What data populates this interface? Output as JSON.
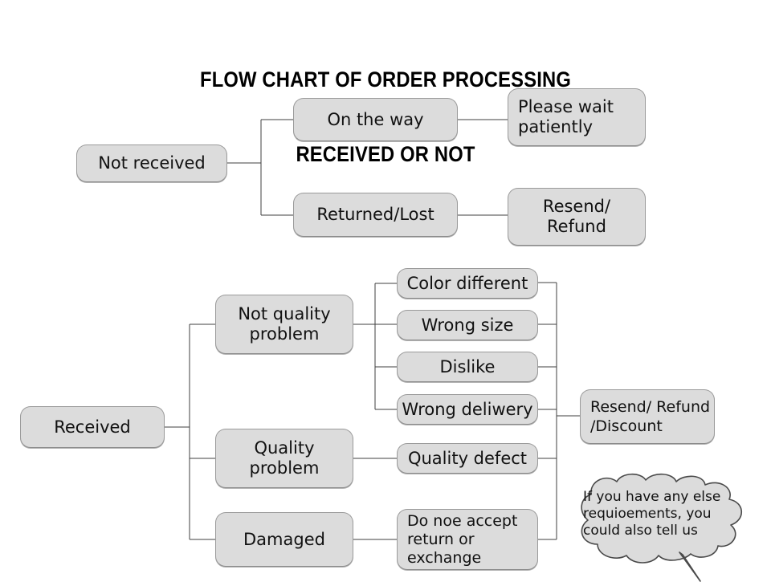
{
  "title": {
    "line1": "FLOW CHART OF ORDER PROCESSING",
    "line2": "RECEIVED OR NOT"
  },
  "colors": {
    "node_fill": "#dcdcdc",
    "node_border": "#9a9a9a",
    "connector": "#3f3f3f",
    "bubble_fill": "#dcdcdc",
    "bubble_border": "#4a4a4a",
    "text": "#111111",
    "background": "#ffffff"
  },
  "chart_data": {
    "type": "diagram",
    "title": "FLOW CHART OF ORDER PROCESSING RECEIVED OR NOT",
    "branches": [
      {
        "root": "Not received",
        "children": [
          {
            "label": "On the way",
            "outcome": "Please wait\npatiently"
          },
          {
            "label": "Returned/Lost",
            "outcome": "Resend/\nRefund"
          }
        ]
      },
      {
        "root": "Received",
        "children": [
          {
            "label": "Not quality\nproblem",
            "reasons": [
              "Color different",
              "Wrong size",
              "Dislike",
              "Wrong deliwery"
            ],
            "outcome": "Resend/ Refund\n/Discount"
          },
          {
            "label": "Quality\nproblem",
            "reasons": [
              "Quality defect"
            ],
            "outcome": "Resend/ Refund\n/Discount"
          },
          {
            "label": "Damaged",
            "reasons": [
              "Do noe accept\nreturn or\nexchange"
            ],
            "outcome": null
          }
        ]
      }
    ],
    "note": "If you have any else\nrequioements, you\ncould also tell us"
  },
  "nodes": {
    "not_received": "Not received",
    "on_the_way": "On the way",
    "please_wait": "Please wait\npatiently",
    "returned_lost": "Returned/Lost",
    "resend_refund": "Resend/\nRefund",
    "received": "Received",
    "not_quality_problem": "Not quality\nproblem",
    "quality_problem": "Quality\nproblem",
    "damaged": "Damaged",
    "color_different": "Color different",
    "wrong_size": "Wrong size",
    "dislike": "Dislike",
    "wrong_deliwery": "Wrong deliwery",
    "quality_defect": "Quality defect",
    "do_not_accept": "Do noe accept\nreturn or\nexchange",
    "resend_refund_discount": "Resend/ Refund\n/Discount"
  },
  "bubble": {
    "text": "If you have any else\nrequioements, you\ncould also tell us"
  }
}
